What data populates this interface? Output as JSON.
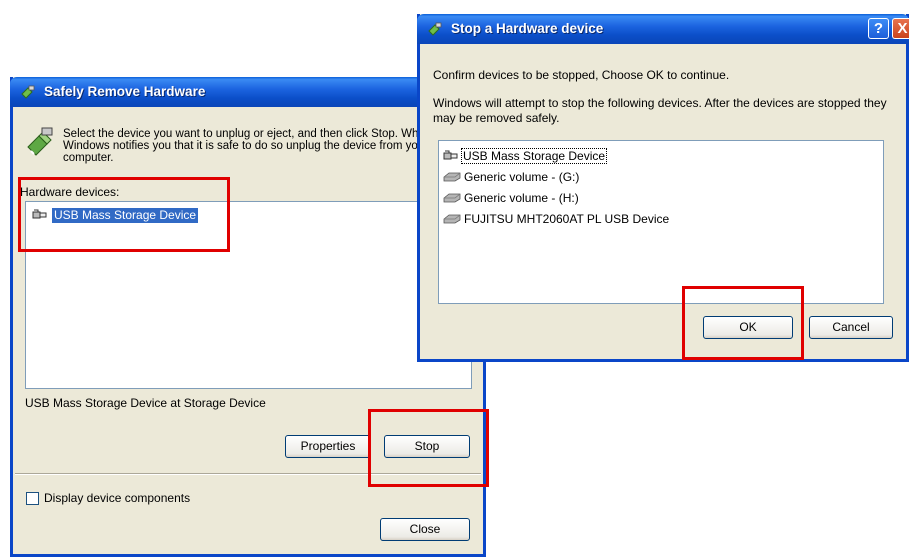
{
  "left_window": {
    "title": "Safely Remove Hardware",
    "instruction_line1": "Select the device you want to unplug or eject, and then click Stop. When",
    "instruction_line2": "Windows notifies you that it is safe to do so unplug the device from your",
    "instruction_line3": "computer.",
    "hardware_devices_label": "Hardware devices:",
    "devices": [
      {
        "label": "USB Mass Storage Device",
        "icon": "usb-plug-icon",
        "selected": true
      }
    ],
    "status_text": "USB Mass Storage Device at Storage Device",
    "properties_label": "Properties",
    "stop_label": "Stop",
    "display_components_label": "Display device components",
    "display_components_checked": false,
    "close_label": "Close"
  },
  "right_window": {
    "title": "Stop a Hardware device",
    "help_glyph": "?",
    "close_glyph": "X",
    "confirm_text": "Confirm devices to be stopped, Choose OK to continue.",
    "warning_text": "Windows will attempt to stop the following devices. After the devices are stopped they may be removed safely.",
    "devices": [
      {
        "label": "USB Mass Storage Device",
        "icon": "usb-plug-icon"
      },
      {
        "label": "Generic volume - (G:)",
        "icon": "drive-icon"
      },
      {
        "label": "Generic volume - (H:)",
        "icon": "drive-icon"
      },
      {
        "label": "FUJITSU MHT2060AT PL USB Device",
        "icon": "drive-icon"
      }
    ],
    "ok_label": "OK",
    "cancel_label": "Cancel"
  },
  "colors": {
    "titlebar_blue": "#0b4fc9",
    "dialog_face": "#ece9d8",
    "selection": "#316ac5",
    "highlight_red": "#e00000"
  }
}
